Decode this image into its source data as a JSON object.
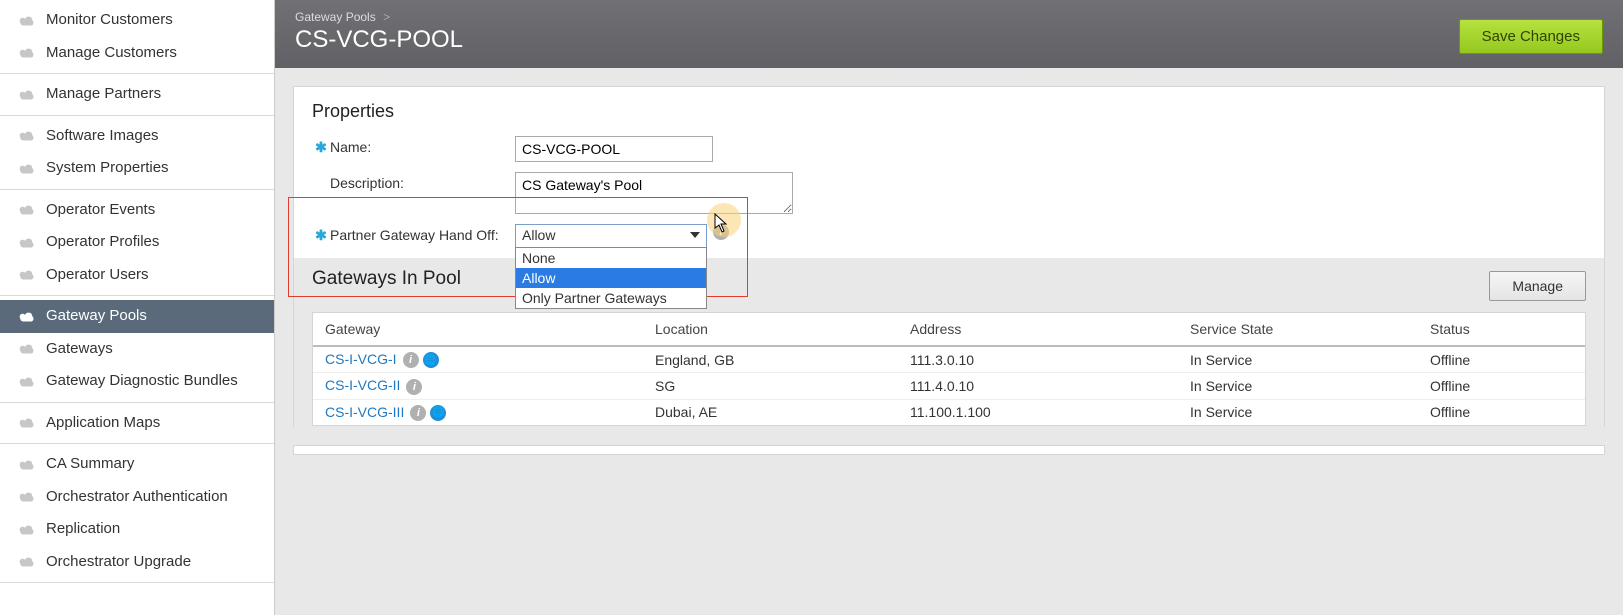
{
  "sidebar": {
    "groups": [
      [
        {
          "label": "Monitor Customers"
        },
        {
          "label": "Manage Customers"
        }
      ],
      [
        {
          "label": "Manage Partners"
        }
      ],
      [
        {
          "label": "Software Images"
        },
        {
          "label": "System Properties"
        }
      ],
      [
        {
          "label": "Operator Events"
        },
        {
          "label": "Operator Profiles"
        },
        {
          "label": "Operator Users"
        }
      ],
      [
        {
          "label": "Gateway Pools",
          "active": true
        },
        {
          "label": "Gateways"
        },
        {
          "label": "Gateway Diagnostic Bundles"
        }
      ],
      [
        {
          "label": "Application Maps"
        }
      ],
      [
        {
          "label": "CA Summary"
        },
        {
          "label": "Orchestrator Authentication"
        },
        {
          "label": "Replication"
        },
        {
          "label": "Orchestrator Upgrade"
        }
      ]
    ]
  },
  "header": {
    "breadcrumb_root": "Gateway Pools",
    "title": "CS-VCG-POOL",
    "save_label": "Save Changes"
  },
  "properties": {
    "heading": "Properties",
    "name_label": "Name:",
    "name_value": "CS-VCG-POOL",
    "description_label": "Description:",
    "description_value": "CS Gateway's Pool",
    "handoff_label": "Partner Gateway Hand Off:",
    "handoff_value": "Allow",
    "handoff_options": [
      "None",
      "Allow",
      "Only Partner Gateways"
    ]
  },
  "gatewaysInPool": {
    "heading": "Gateways In Pool",
    "manage_label": "Manage",
    "columns": [
      "Gateway",
      "Location",
      "Address",
      "Service State",
      "Status"
    ],
    "rows": [
      {
        "gateway": "CS-I-VCG-I",
        "hasGlobe": true,
        "location": "England, GB",
        "address": "111.3.0.10",
        "service": "In Service",
        "status": "Offline"
      },
      {
        "gateway": "CS-I-VCG-II",
        "hasGlobe": false,
        "location": "SG",
        "address": "111.4.0.10",
        "service": "In Service",
        "status": "Offline"
      },
      {
        "gateway": "CS-I-VCG-III",
        "hasGlobe": true,
        "location": "Dubai, AE",
        "address": "11.100.1.100",
        "service": "In Service",
        "status": "Offline"
      }
    ]
  }
}
